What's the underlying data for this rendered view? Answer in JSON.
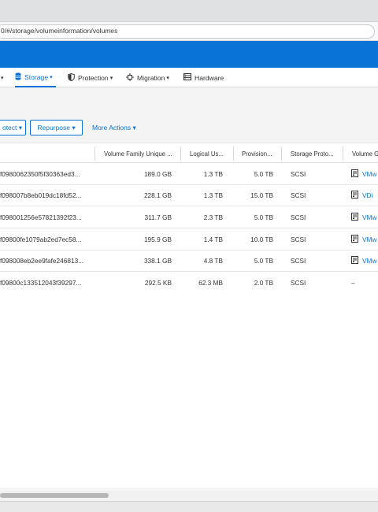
{
  "browser": {
    "url": "0/#/storage/volumeinformation/volumes"
  },
  "nav": {
    "items": [
      {
        "label": "Storage",
        "caret": "▾",
        "icon": "database-icon",
        "active": true
      },
      {
        "label": "Protection",
        "caret": "▾",
        "icon": "shield-icon"
      },
      {
        "label": "Migration",
        "caret": "▾",
        "icon": "migration-icon"
      },
      {
        "label": "Hardware",
        "icon": "hardware-icon"
      }
    ],
    "leading_caret": "▾"
  },
  "toolbar": {
    "protect_label": "otect ▾",
    "repurpose_label": "Repurpose ▾",
    "more_actions_label": "More Actions ▾"
  },
  "table": {
    "headers": [
      "Volume Family Unique ...",
      "Logical Us...",
      "Provision...",
      "Storage Proto...",
      "Volume G"
    ],
    "rows": [
      {
        "id": "f0980062350f5f30363ed3...",
        "family": "189.0 GB",
        "logical": "1.3 TB",
        "provisioned": "5.0 TB",
        "protocol": "SCSI",
        "group": "VMw",
        "has_group_icon": true
      },
      {
        "id": "f098007b8eb019dc18fd52...",
        "family": "228.1 GB",
        "logical": "1.3 TB",
        "provisioned": "15.0 TB",
        "protocol": "SCSI",
        "group": "VDi",
        "has_group_icon": true
      },
      {
        "id": "f098001256e57821392f23...",
        "family": "311.7 GB",
        "logical": "2.3 TB",
        "provisioned": "5.0 TB",
        "protocol": "SCSI",
        "group": "VMw",
        "has_group_icon": true
      },
      {
        "id": "f09800fe1079ab2ed7ec58...",
        "family": "195.9 GB",
        "logical": "1.4 TB",
        "provisioned": "10.0 TB",
        "protocol": "SCSI",
        "group": "VMw",
        "has_group_icon": true
      },
      {
        "id": "f098008eb2ee9fafe246813...",
        "family": "338.1 GB",
        "logical": "4.8 TB",
        "provisioned": "5.0 TB",
        "protocol": "SCSI",
        "group": "VMw",
        "has_group_icon": true
      },
      {
        "id": "f09800c133512043f39297...",
        "family": "292.5 KB",
        "logical": "62.3 MB",
        "provisioned": "2.0 TB",
        "protocol": "SCSI",
        "group": "–",
        "has_group_icon": false
      }
    ]
  },
  "colors": {
    "accent": "#0a74d6",
    "header": "#0a74d6",
    "background": "#f4f4f4"
  }
}
